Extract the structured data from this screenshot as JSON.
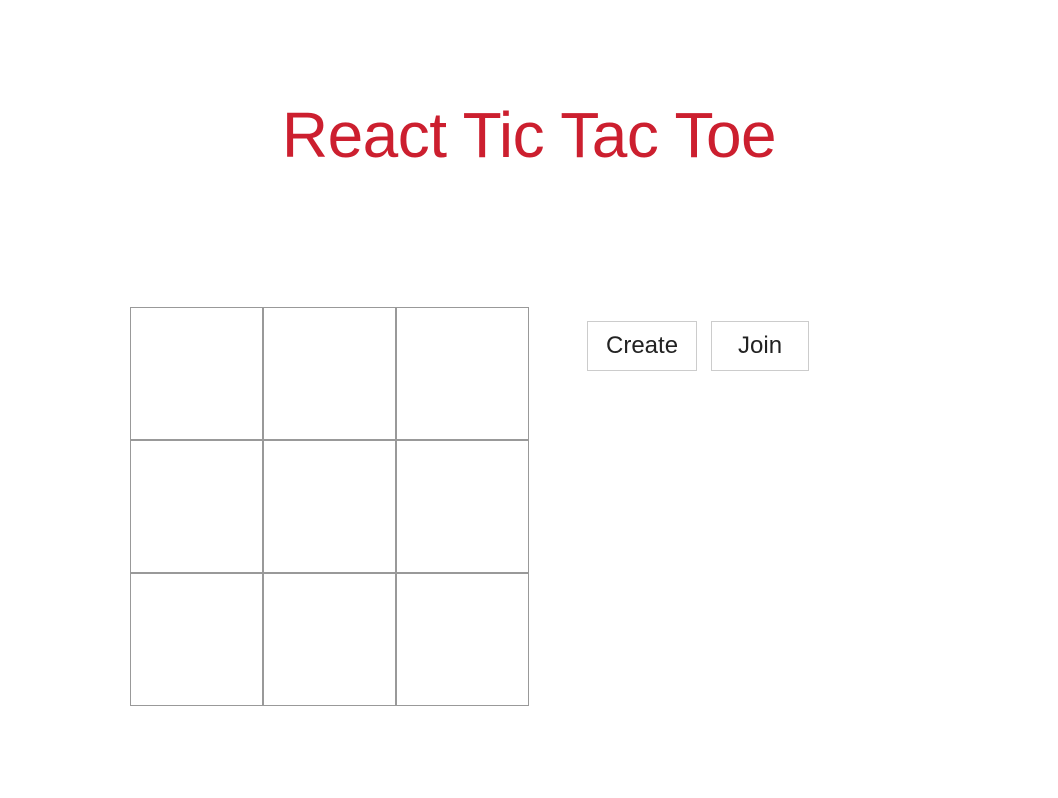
{
  "title": "React Tic Tac Toe",
  "buttons": {
    "create_label": "Create",
    "join_label": "Join"
  },
  "board": {
    "cells": [
      "",
      "",
      "",
      "",
      "",
      "",
      "",
      "",
      ""
    ]
  },
  "colors": {
    "title": "#cc1f2f",
    "border": "#999999",
    "button_border": "#cccccc"
  }
}
